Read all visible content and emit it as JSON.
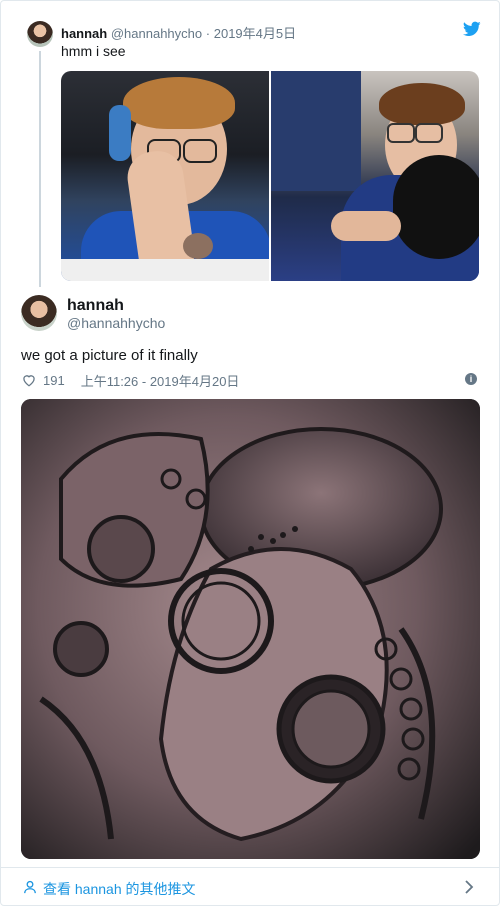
{
  "parent_tweet": {
    "name": "hannah",
    "handle": "@hannahhycho",
    "separator": "·",
    "date": "2019年4月5日",
    "text": "hmm i see"
  },
  "main_tweet": {
    "name": "hannah",
    "handle": "@hannahhycho",
    "text": "we got a picture of it finally",
    "likes": "191",
    "timestamp": "上午11:26 - 2019年4月20日"
  },
  "footer": {
    "label": "查看 hannah 的其他推文"
  },
  "icons": {
    "brand": "twitter-bird-icon",
    "like": "heart-icon",
    "info": "info-icon",
    "user": "user-icon",
    "chevron": "chevron-right-icon"
  },
  "colors": {
    "accent": "#1b95e0",
    "twitter_blue": "#1da1f2",
    "muted": "#657786",
    "border": "#e1e8ed"
  }
}
